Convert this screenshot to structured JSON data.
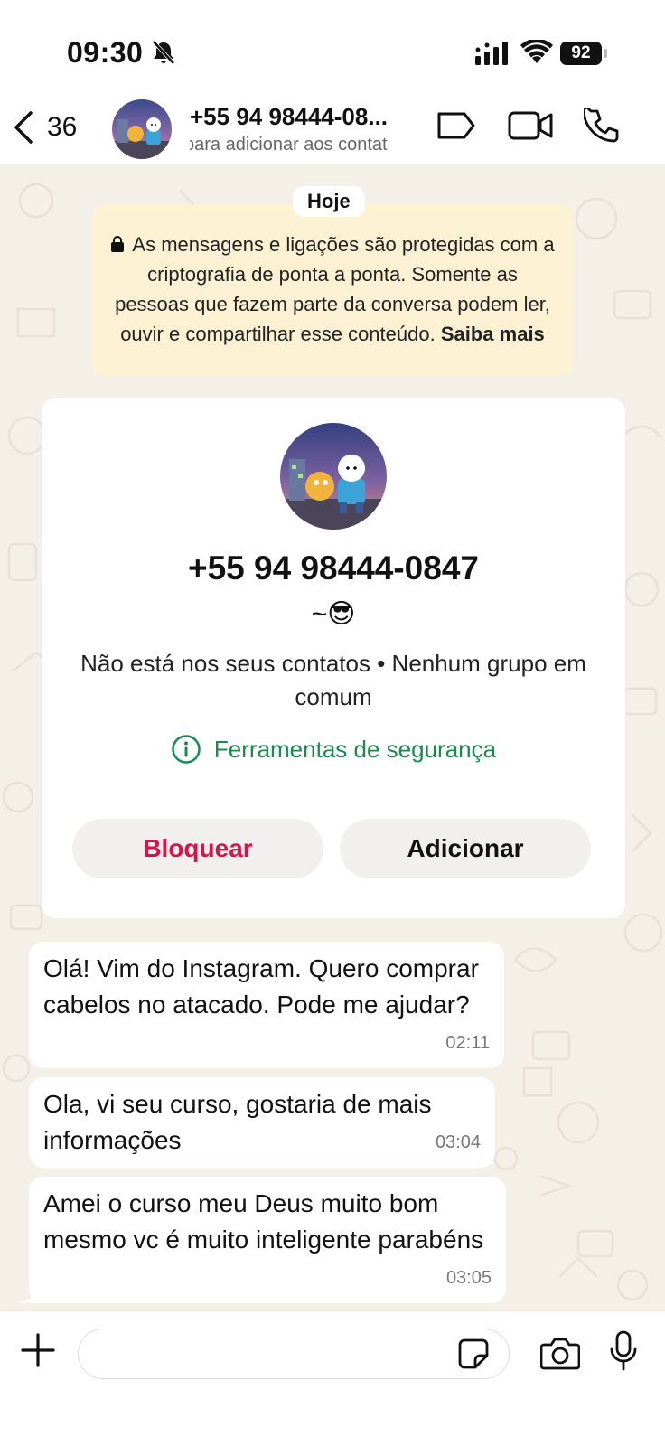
{
  "status_bar": {
    "time": "09:30",
    "battery": "92",
    "icons": [
      "bell-slash-icon",
      "signal-icon",
      "wifi-icon",
      "battery-icon"
    ]
  },
  "header": {
    "back_count": "36",
    "contact_name": "+55 94 98444-08...",
    "contact_subtitle": "para adicionar aos contat",
    "icons": [
      "chevron-left-icon",
      "label-icon",
      "video-call-icon",
      "phone-icon"
    ]
  },
  "chat": {
    "date_label": "Hoje",
    "encryption_notice": {
      "text": "As mensagens e ligações são protegidas com a criptografia de ponta a ponta. Somente as pessoas que fazem parte da conversa podem ler, ouvir e compartilhar esse conteúdo.",
      "link": "Saiba mais"
    },
    "contact_card": {
      "number": "+55 94 98444-0847",
      "about": "~😎",
      "info": "Não está nos seus contatos • Nenhum grupo em comum",
      "security_link": "Ferramentas de segurança",
      "block_label": "Bloquear",
      "add_label": "Adicionar"
    },
    "messages": [
      {
        "text": "Olá! Vim do Instagram. Quero comprar cabelos no atacado. Pode me ajudar?",
        "time": "02:11"
      },
      {
        "text": "Ola, vi seu curso, gostaria de mais informações",
        "time": "03:04"
      },
      {
        "text": "Amei o curso meu Deus muito bom mesmo vc é muito inteligente parabéns",
        "time": "03:05"
      }
    ]
  },
  "input_bar": {
    "placeholder": "",
    "icons": [
      "plus-icon",
      "sticker-icon",
      "camera-icon",
      "microphone-icon"
    ]
  },
  "colors": {
    "encryption_bg": "#fdf1d4",
    "security_green": "#1a8a4e",
    "block_red": "#d8124a",
    "wallpaper": "#f4efe7"
  }
}
